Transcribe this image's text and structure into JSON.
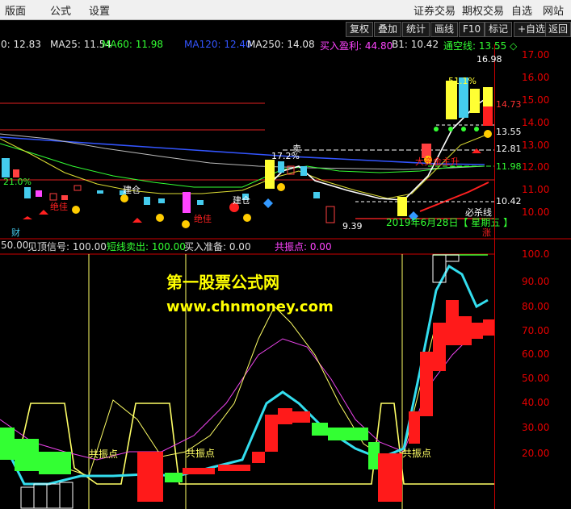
{
  "menubar": {
    "left": [
      "版面",
      "公式",
      "设置"
    ],
    "right": [
      "证券交易",
      "期权交易",
      "自选",
      "网站"
    ]
  },
  "toolbar": {
    "buttons": [
      "复权",
      "叠加",
      "统计",
      "画线",
      "F10",
      "标记",
      "+自选",
      "返回"
    ]
  },
  "ma_info": [
    {
      "label": "0: 12.83",
      "color": "#e6e6e6"
    },
    {
      "label": "MA25: 11.54",
      "color": "#e6e6e6"
    },
    {
      "label": "MA60: 11.98",
      "color": "#33ff33"
    },
    {
      "label": "MA120: 12.40",
      "color": "#3355ff"
    },
    {
      "label": "MA250: 14.08",
      "color": "#e6e6e6"
    },
    {
      "label": "买入盈利: 44.80",
      "color": "#ff44ff"
    },
    {
      "label": "B1: 10.42",
      "color": "#e6e6e6"
    },
    {
      "label": "通空线: 13.55 ◇",
      "color": "#33ff33"
    }
  ],
  "price_axis": [
    "17.00",
    "16.00",
    "15.00",
    "14.00",
    "13.00",
    "12.00",
    "11.00",
    "10.00"
  ],
  "price_markers": [
    {
      "label": "16.98",
      "color": "#ffffff"
    },
    {
      "label": "14.73",
      "color": "#ff3333"
    },
    {
      "label": "13.55",
      "color": "#ffffff"
    },
    {
      "label": "12.81",
      "color": "#ffffff"
    },
    {
      "label": "11.98",
      "color": "#33ff33"
    },
    {
      "label": "10.42",
      "color": "#ffffff"
    },
    {
      "label": "9.39",
      "color": "#ffffff"
    }
  ],
  "chart_annotations": {
    "date_text": "2019年6月28日【 星期五 】",
    "bisha": "必杀线",
    "pct_171": "17.2%",
    "pct_21": "21.0%",
    "pct_51": "51.1%",
    "jueshao": "绝佳",
    "jiancang": "建仓",
    "mai": "卖",
    "cai": "财",
    "zhuli": "大资金主升",
    "baozhang": "涨"
  },
  "indicator_info": [
    {
      "label": "50.00",
      "color": "#e6e6e6"
    },
    {
      "label": "见顶信号: 100.00",
      "color": "#e6e6e6"
    },
    {
      "label": "短线卖出: 100.00",
      "color": "#33ff33"
    },
    {
      "label": "买入准备: 0.00",
      "color": "#e6e6e6"
    },
    {
      "label": "共振点: 0.00",
      "color": "#ff44ff"
    }
  ],
  "indicator_axis": [
    "100.0",
    "90.00",
    "80.00",
    "70.00",
    "60.00",
    "50.00",
    "40.00",
    "30.00",
    "20.00"
  ],
  "resonance_label": "共振点",
  "watermark": {
    "line1": "第一股票公式网",
    "line2": "www.chnmoney.com"
  }
}
